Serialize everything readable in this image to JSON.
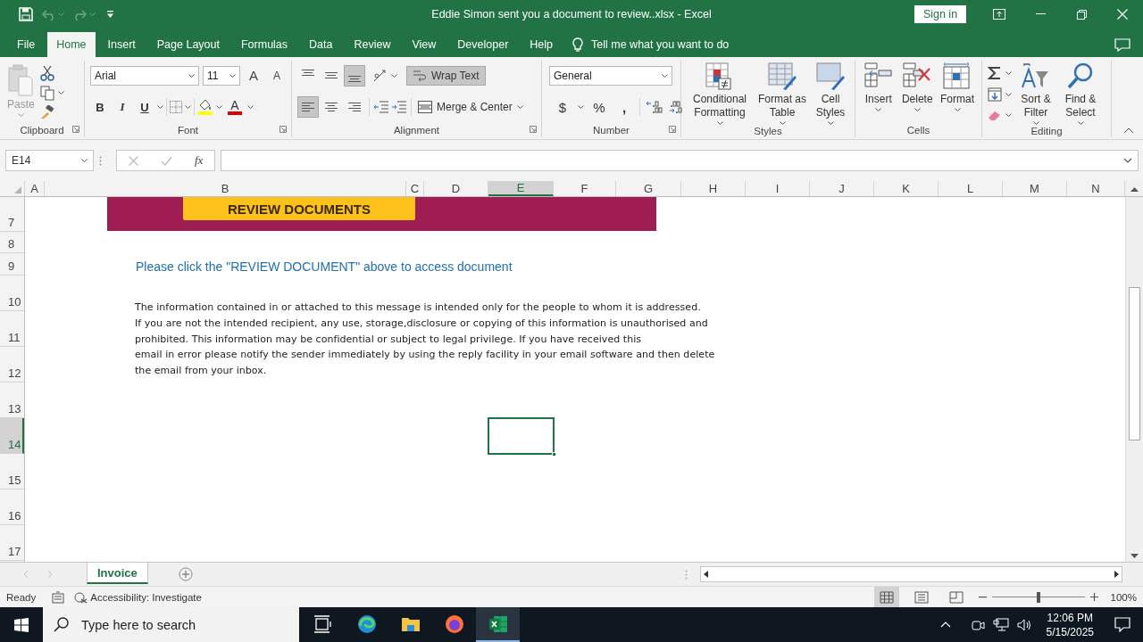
{
  "title_bar": {
    "title": "Eddie Simon sent you a document to review..xlsx  -  Excel",
    "sign_in": "Sign in"
  },
  "ribbon_tabs": [
    {
      "label": "File",
      "selected": false
    },
    {
      "label": "Home",
      "selected": true
    },
    {
      "label": "Insert",
      "selected": false
    },
    {
      "label": "Page Layout",
      "selected": false
    },
    {
      "label": "Formulas",
      "selected": false
    },
    {
      "label": "Data",
      "selected": false
    },
    {
      "label": "Review",
      "selected": false
    },
    {
      "label": "View",
      "selected": false
    },
    {
      "label": "Developer",
      "selected": false
    },
    {
      "label": "Help",
      "selected": false
    }
  ],
  "tell_me": "Tell me what you want to do",
  "ribbon": {
    "clipboard": {
      "label": "Clipboard",
      "paste": "Paste"
    },
    "font": {
      "label": "Font",
      "font_name": "Arial",
      "font_size": "11",
      "grow": "A",
      "shrink": "A",
      "bold": "B",
      "italic": "I",
      "underline": "U",
      "font_color": "A"
    },
    "alignment": {
      "label": "Alignment",
      "vertical": [
        {
          "selected": false
        },
        {
          "selected": false
        },
        {
          "selected": true
        }
      ],
      "horizontal": [
        {
          "selected": true
        },
        {
          "selected": false
        },
        {
          "selected": false
        }
      ],
      "wrap_text": {
        "label": "Wrap Text",
        "on": true
      },
      "merge": "Merge & Center"
    },
    "number": {
      "label": "Number",
      "format": "General",
      "currency": "$",
      "percent": "%",
      "comma": ","
    },
    "styles": {
      "label": "Styles",
      "buttons": [
        "Conditional Formatting",
        "Format as Table",
        "Cell Styles"
      ]
    },
    "cells": {
      "label": "Cells",
      "buttons": [
        "Insert",
        "Delete",
        "Format"
      ]
    },
    "editing": {
      "label": "Editing",
      "buttons": [
        "Sort & Filter",
        "Find & Select"
      ]
    }
  },
  "formula_bar": {
    "name_box": "E14",
    "function_button": "fx"
  },
  "columns": [
    {
      "label": "A",
      "selected": false
    },
    {
      "label": "B",
      "selected": false
    },
    {
      "label": "C",
      "selected": false
    },
    {
      "label": "D",
      "selected": false
    },
    {
      "label": "E",
      "selected": true
    },
    {
      "label": "F",
      "selected": false
    },
    {
      "label": "G",
      "selected": false
    },
    {
      "label": "H",
      "selected": false
    },
    {
      "label": "I",
      "selected": false
    },
    {
      "label": "J",
      "selected": false
    },
    {
      "label": "K",
      "selected": false
    },
    {
      "label": "L",
      "selected": false
    },
    {
      "label": "M",
      "selected": false
    },
    {
      "label": "N",
      "selected": false
    }
  ],
  "rows": [
    {
      "label": "7",
      "selected": false
    },
    {
      "label": "8",
      "selected": false
    },
    {
      "label": "9",
      "selected": false
    },
    {
      "label": "10",
      "selected": false
    },
    {
      "label": "11",
      "selected": false
    },
    {
      "label": "12",
      "selected": false
    },
    {
      "label": "13",
      "selected": false
    },
    {
      "label": "14",
      "selected": true
    },
    {
      "label": "15",
      "selected": false
    },
    {
      "label": "16",
      "selected": false
    },
    {
      "label": "17",
      "selected": false
    }
  ],
  "sheet": {
    "banner_button": "REVIEW DOCUMENTS",
    "link": "Please click the \"REVIEW DOCUMENT\" above to access document",
    "disclaimer": [
      "The information contained in or attached to this message is intended only for the people to whom it is addressed.",
      "If you are not the intended recipient, any use, storage,disclosure or copying of this information is unauthorised and",
      "prohibited. This information may be confidential or subject to legal privilege. If you have received this",
      "email in error please notify the sender immediately by using the reply facility in your email software and then delete",
      "the email from your inbox."
    ]
  },
  "sheet_tabs": [
    {
      "label": "Invoice",
      "selected": true
    }
  ],
  "status_bar": {
    "status": "Ready",
    "accessibility": "Accessibility: Investigate",
    "views": [
      {
        "kind": "normal",
        "selected": true
      },
      {
        "kind": "page_layout",
        "selected": false
      },
      {
        "kind": "page_break",
        "selected": false
      }
    ],
    "zoom": {
      "level": 0.5,
      "reading": "100%"
    }
  },
  "taskbar": {
    "search_placeholder": "Type here to search",
    "apps": [
      {
        "kind": "task_view",
        "selected": false
      },
      {
        "kind": "edge",
        "selected": false
      },
      {
        "kind": "explorer",
        "selected": false
      },
      {
        "kind": "firefox",
        "selected": false
      },
      {
        "kind": "excel",
        "selected": true
      }
    ],
    "time": "12:06 PM",
    "date": "5/15/2025"
  }
}
